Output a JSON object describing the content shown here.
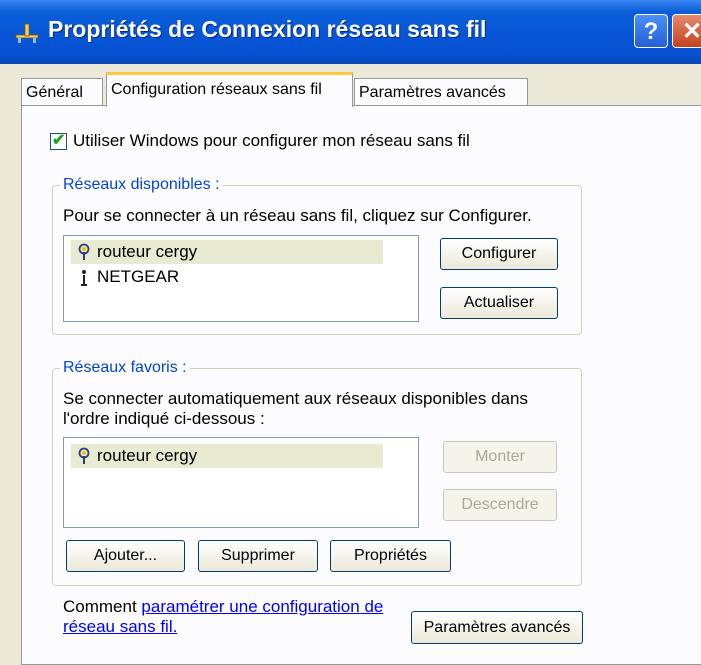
{
  "window": {
    "title": "Propriétés de Connexion réseau sans fil",
    "help_glyph": "?",
    "close_glyph": "✕"
  },
  "tabs": [
    {
      "label": "Général"
    },
    {
      "label": "Configuration réseaux sans fil"
    },
    {
      "label": "Paramètres avancés"
    }
  ],
  "use_windows": {
    "checked": true,
    "label": "Utiliser Windows pour configurer mon réseau sans fil"
  },
  "available_networks": {
    "legend": "Réseaux disponibles :",
    "description": "Pour se connecter à un réseau sans fil, cliquez sur Configurer.",
    "items": [
      {
        "name": "routeur cergy",
        "icon": "wireless-antenna-configured-icon"
      },
      {
        "name": "NETGEAR",
        "icon": "wireless-antenna-icon"
      }
    ],
    "buttons": {
      "configure": "Configurer",
      "refresh": "Actualiser"
    }
  },
  "preferred_networks": {
    "legend": "Réseaux favoris :",
    "description_line1": "Se connecter automatiquement aux réseaux disponibles dans",
    "description_line2": "l'ordre indiqué ci-dessous :",
    "items": [
      {
        "name": "routeur cergy",
        "icon": "wireless-antenna-configured-icon"
      }
    ],
    "buttons": {
      "move_up": "Monter",
      "move_down": "Descendre",
      "add": "Ajouter...",
      "remove": "Supprimer",
      "properties": "Propriétés"
    }
  },
  "footer": {
    "prefix": "Comment ",
    "link_line1": "paramétrer une configuration de",
    "link_line2": "réseau sans fil.",
    "advanced_button": "Paramètres avancés"
  },
  "colors": {
    "titlebar": "#0755d6",
    "legend_text": "#0046d5",
    "link": "#0000ff",
    "active_tab_highlight": "#ffc83c"
  }
}
